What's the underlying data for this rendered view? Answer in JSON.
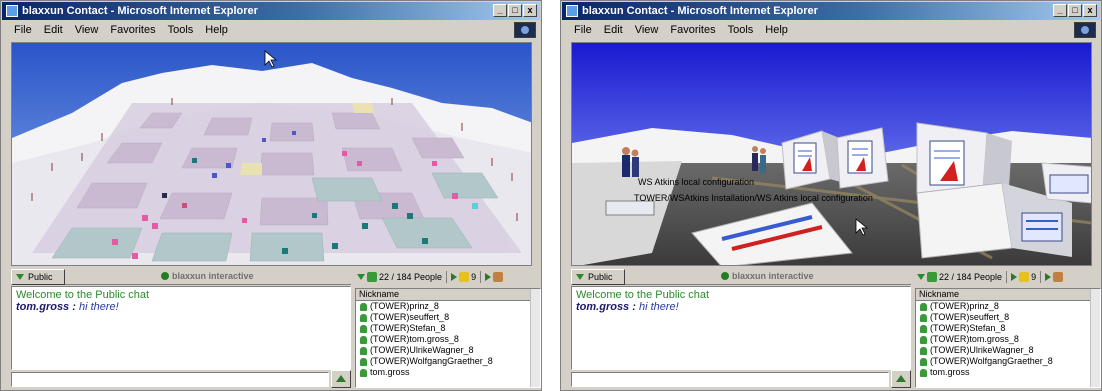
{
  "windows": [
    {
      "title": "blaxxun Contact - Microsoft Internet Explorer",
      "menu": [
        "File",
        "Edit",
        "View",
        "Favorites",
        "Tools",
        "Help"
      ],
      "title_buttons": [
        "_",
        "□",
        "x"
      ],
      "chat": {
        "tab_label": "Public",
        "brand": "blaxxun interactive",
        "welcome": "Welcome to the Public chat",
        "user": "tom.gross :",
        "message": "hi there!"
      },
      "people": {
        "count": "22 / 184 People",
        "pages": "9"
      },
      "nicklist": {
        "header": "Nickname",
        "items": [
          "(TOWER)prinz_8",
          "(TOWER)seuffert_8",
          "(TOWER)Stefan_8",
          "(TOWER)tom.gross_8",
          "(TOWER)UlrikeWagner_8",
          "(TOWER)WolfgangGraether_8",
          "tom.gross"
        ]
      }
    },
    {
      "title": "blaxxun Contact - Microsoft Internet Explorer",
      "menu": [
        "File",
        "Edit",
        "View",
        "Favorites",
        "Tools",
        "Help"
      ],
      "title_buttons": [
        "_",
        "□",
        "x"
      ],
      "scene_labels": [
        "WS Atkins local configuration",
        "TOWER/WSAtkins Installation/WS Atkins local configuration"
      ],
      "chat": {
        "tab_label": "Public",
        "brand": "blaxxun interactive",
        "welcome": "Welcome to the Public chat",
        "user": "tom.gross :",
        "message": "hi there!"
      },
      "people": {
        "count": "22 / 184 People",
        "pages": "9"
      },
      "nicklist": {
        "header": "Nickname",
        "items": [
          "(TOWER)prinz_8",
          "(TOWER)seuffert_8",
          "(TOWER)Stefan_8",
          "(TOWER)tom.gross_8",
          "(TOWER)UlrikeWagner_8",
          "(TOWER)WolfgangGraether_8",
          "tom.gross"
        ]
      }
    }
  ]
}
